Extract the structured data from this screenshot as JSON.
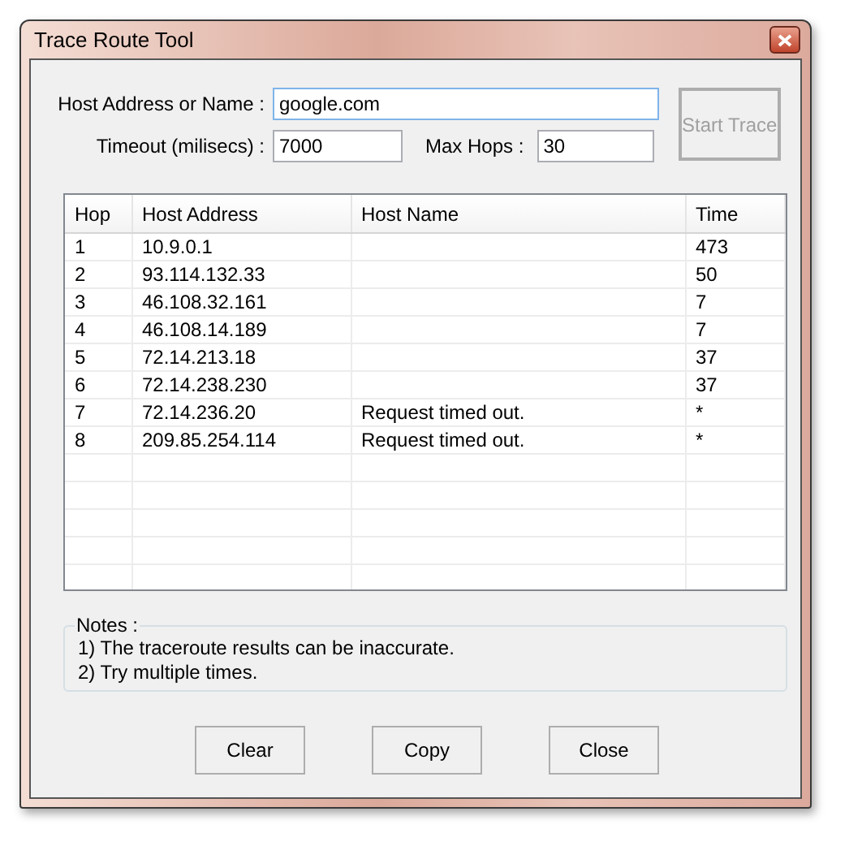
{
  "window": {
    "title": "Trace Route Tool"
  },
  "form": {
    "host_label": "Host Address or Name :",
    "host_value": "google.com",
    "timeout_label": "Timeout (milisecs) :",
    "timeout_value": "7000",
    "max_hops_label": "Max Hops :",
    "max_hops_value": "30",
    "start_button": {
      "label": "Start Trace",
      "disabled": true
    }
  },
  "table": {
    "columns": [
      "Hop",
      "Host Address",
      "Host Name",
      "Time"
    ],
    "rows": [
      [
        "1",
        "10.9.0.1",
        "",
        "473"
      ],
      [
        "2",
        "93.114.132.33",
        "",
        "50"
      ],
      [
        "3",
        "46.108.32.161",
        "",
        "7"
      ],
      [
        "4",
        "46.108.14.189",
        "",
        "7"
      ],
      [
        "5",
        "72.14.213.18",
        "",
        "37"
      ],
      [
        "6",
        "72.14.238.230",
        "",
        "37"
      ],
      [
        "7",
        "72.14.236.20",
        "Request timed out.",
        "*"
      ],
      [
        "8",
        "209.85.254.114",
        "Request timed out.",
        "*"
      ]
    ]
  },
  "notes": {
    "title": "Notes :",
    "lines": [
      "1) The traceroute results can be inaccurate.",
      "2) Try multiple times."
    ]
  },
  "buttons": [
    "Clear",
    "Copy",
    "Close"
  ]
}
